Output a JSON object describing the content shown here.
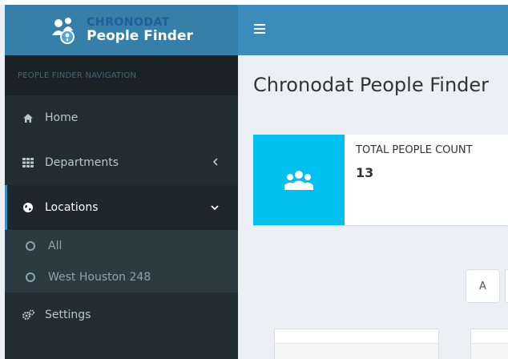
{
  "logo": {
    "brand": "CHRONODAT",
    "product": "People Finder"
  },
  "sidebar": {
    "header": "PEOPLE FINDER NAVIGATION",
    "items": [
      {
        "label": "Home",
        "icon": "home-icon"
      },
      {
        "label": "Departments",
        "icon": "grid-icon",
        "chevron": "chevron-left-icon"
      },
      {
        "label": "Locations",
        "icon": "globe-icon",
        "chevron": "chevron-down-icon",
        "active": true
      },
      {
        "label": "Settings",
        "icon": "gears-icon"
      }
    ],
    "locations_submenu": [
      {
        "label": "All"
      },
      {
        "label": "West Houston 248"
      }
    ]
  },
  "main": {
    "page_title": "Chronodat People Finder",
    "info_box": {
      "label": "TOTAL PEOPLE COUNT",
      "value": "13",
      "icon": "users-icon"
    },
    "alpha_filter": [
      "A"
    ]
  },
  "colors": {
    "logo_bar": "#367fa9",
    "header_bar": "#3c8dbc",
    "sidebar_bg": "#222d32",
    "info_icon_bg": "#00c0ef",
    "content_bg": "#ecf0f5"
  }
}
